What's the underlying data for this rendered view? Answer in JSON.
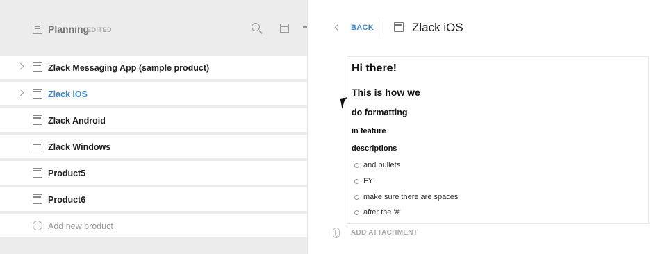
{
  "left_header": {
    "title": "Planning",
    "edited_badge": "EDITED"
  },
  "products": [
    {
      "label": "Zlack Messaging App (sample product)",
      "expandable": true,
      "active": false
    },
    {
      "label": "Zlack iOS",
      "expandable": true,
      "active": true
    },
    {
      "label": "Zlack Android",
      "expandable": false,
      "active": false
    },
    {
      "label": "Zlack Windows",
      "expandable": false,
      "active": false
    },
    {
      "label": "Product5",
      "expandable": false,
      "active": false
    },
    {
      "label": "Product6",
      "expandable": false,
      "active": false
    }
  ],
  "add_product_label": "Add new product",
  "detail": {
    "back_label": "BACK",
    "title": "Zlack iOS",
    "editor": {
      "h1": "Hi there!",
      "h2": "This is how we",
      "h3": "do formatting",
      "h4": "in feature",
      "h5": "descriptions",
      "bullets": [
        "and bullets",
        "FYI",
        "make sure there are spaces",
        "after the '#'"
      ]
    },
    "attachment_label": "ADD ATTACHMENT"
  },
  "colors": {
    "accent": "#3b86cf",
    "background": "#ececec"
  }
}
